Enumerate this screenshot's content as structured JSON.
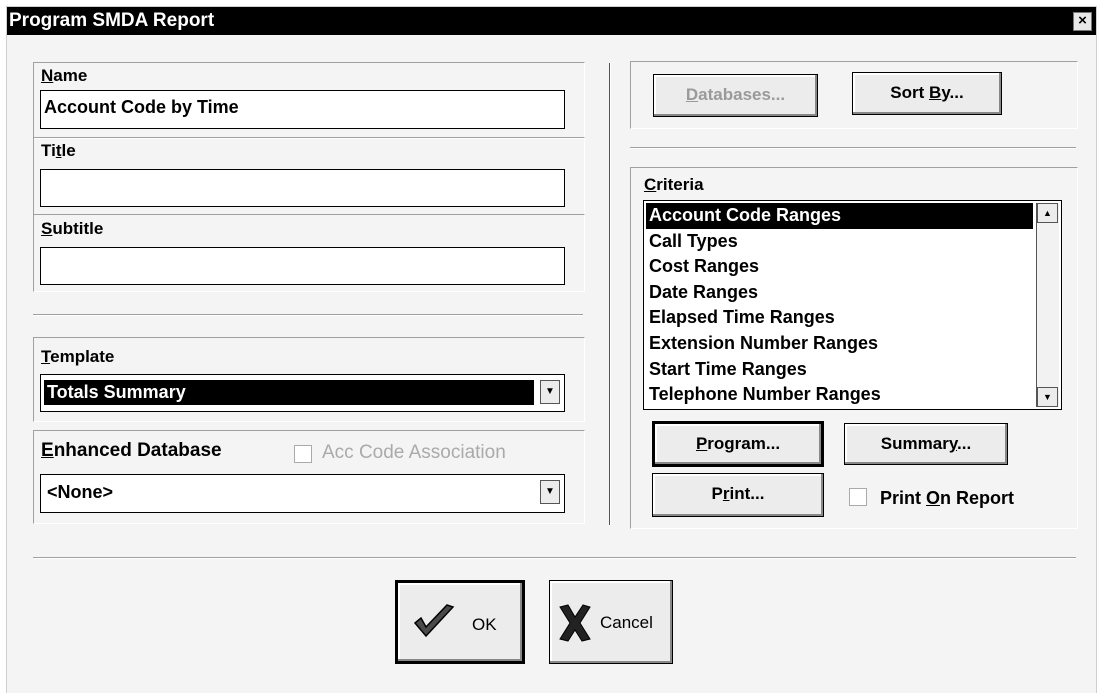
{
  "window": {
    "title": "Program SMDA Report",
    "close_glyph": "×"
  },
  "name": {
    "label_u": "N",
    "label_rest": "ame",
    "value": "Account Code by Time"
  },
  "title": {
    "label_pre": "Ti",
    "label_u": "t",
    "label_rest": "le",
    "value": ""
  },
  "subtitle": {
    "label_u": "S",
    "label_rest": "ubtitle",
    "value": ""
  },
  "template": {
    "label_u": "T",
    "label_rest": "emplate",
    "value": "Totals Summary"
  },
  "enhanced": {
    "label_u": "E",
    "label_rest": "nhanced Database",
    "value": "<None>",
    "acc_label": "Acc Code Association"
  },
  "buttons": {
    "databases_u": "D",
    "databases_rest": "atabases...",
    "sortby_pre": "Sort ",
    "sortby_u": "B",
    "sortby_rest": "y...",
    "program_u": "P",
    "program_rest": "rogram...",
    "summary_pre": "Summar",
    "summary_u": "y",
    "summary_rest": "...",
    "print_pre": "P",
    "print_u": "r",
    "print_rest": "int...",
    "ok": "OK",
    "cancel": "Cancel"
  },
  "criteria": {
    "label_u": "C",
    "label_rest": "riteria",
    "items": [
      "Account Code Ranges",
      "Call Types",
      "Cost Ranges",
      "Date Ranges",
      "Elapsed Time Ranges",
      "Extension Number Ranges",
      "Start Time Ranges",
      "Telephone Number Ranges"
    ],
    "selected_index": 0
  },
  "print_on_report": {
    "label_pre": "Print ",
    "label_u": "O",
    "label_rest": "n Report"
  }
}
